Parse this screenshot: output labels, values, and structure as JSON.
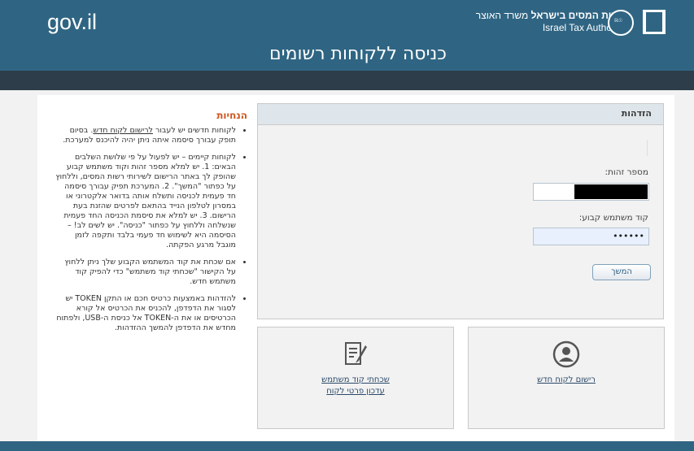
{
  "header": {
    "site_logo": "gov.il",
    "authority_he_bold": "רשות המסים בישראל",
    "authority_he_rest": " משרד האוצר",
    "authority_en": "Israel Tax Authority",
    "page_title": "כניסה ללקוחות רשומים"
  },
  "guide": {
    "title": "הנחיות",
    "items": [
      {
        "prefix": "לקוחות חדשים יש לעבור ",
        "link": "לרישום לקוח חדש",
        "suffix": ". בסיום תופק עבורך סיסמה איתה ניתן יהיה להיכנס למערכת."
      },
      {
        "text": "לקוחות קיימים – יש לפעול על פי שלושת השלבים הבאים: 1. יש למלא מספר זהות וקוד משתמש קבוע שהופק לך באתר הרישום לשירותי רשות המסים, וללחוץ על כפתור \"המשך\". 2. המערכת תפיק עבורך סיסמה חד פעמית לכניסה ותשלח אותה בדואר אלקטרוני או במסרון לטלפון הנייד בהתאם לפרטים שהזנת בעת הרישום. 3. יש למלא את סיסמת הכניסה החד פעמית שנשלחה וללחוץ על כפתור \"כניסה\". יש לשים לב! – הסיסמה היא לשימוש חד פעמי בלבד ותקפה לזמן מוגבל מרגע הפקתה."
      },
      {
        "text": "אם שכחת את קוד המשתמש הקבוע שלך ניתן ללחוץ על הקישור \"שכחתי קוד משתמש\" כדי להפיק קוד משתמש חדש."
      },
      {
        "text": "להזדהות באמצעות כרטיס חכם או התקן TOKEN יש לסגור את הדפדפן, להכניס את הכרטיס אל קורא הכרטיסים או את ה-TOKEN אל כניסת ה-USB, ולפתוח מחדש את הדפדפן להמשך ההזדהות."
      }
    ]
  },
  "login": {
    "heading": "הזדהות",
    "id_label": "מספר זהות:",
    "user_code_label": "קוד משתמש קבוע:",
    "user_code_value": "••••••",
    "continue_button": "המשך"
  },
  "cards": {
    "register_link": "רישום לקוח חדש",
    "forgot_link_1": "שכחתי קוד משתמש",
    "forgot_link_2": "עדכון פרטי לקוח"
  },
  "colors": {
    "header_bg": "#2f6583",
    "dark_bar": "#2d3d4a",
    "guide_title": "#d0551c",
    "link": "#2b4a6a"
  }
}
